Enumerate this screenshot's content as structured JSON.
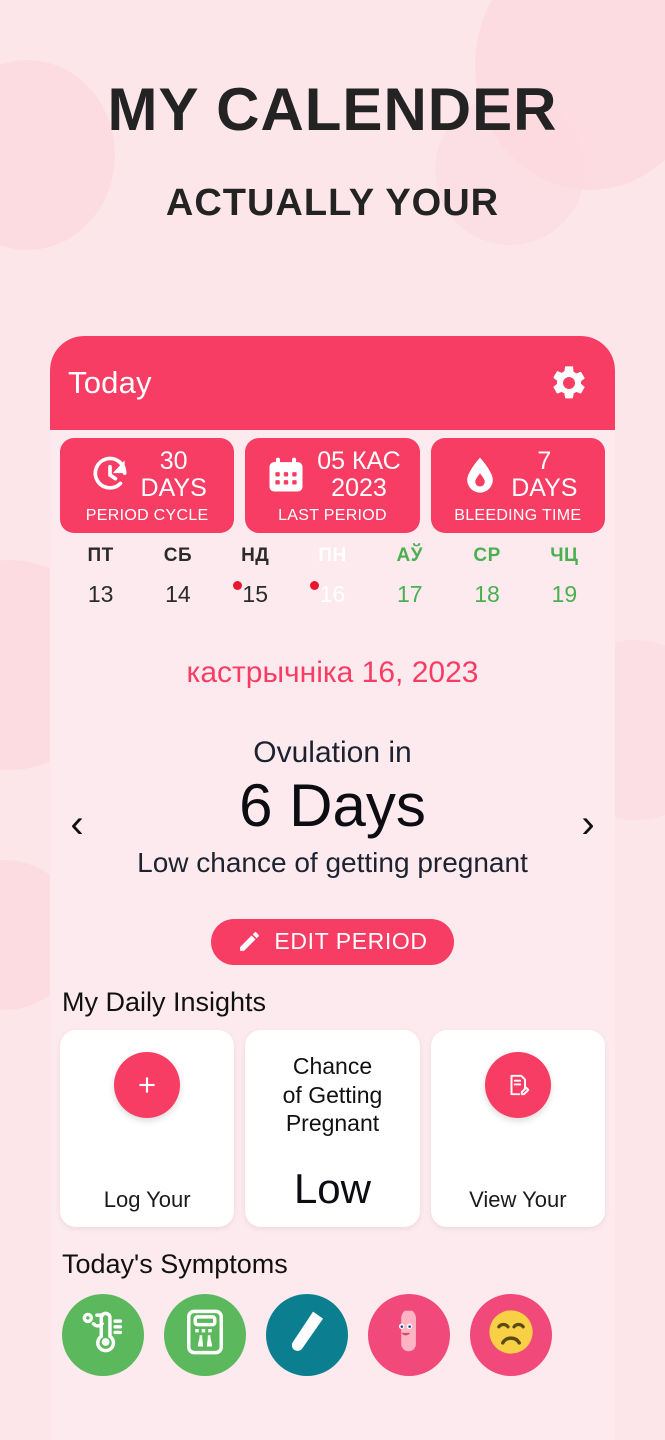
{
  "promo": {
    "title": "MY CALENDER",
    "subtitle": "ACTUALLY YOUR"
  },
  "colors": {
    "accent": "#f73d63",
    "background": "#fde6ea",
    "phone_background": "#fdeaee",
    "future_day": "#4caf50",
    "dot": "#e8172e",
    "card_white": "#ffffff"
  },
  "app": {
    "header": {
      "title": "Today",
      "settings_icon": "gear-icon"
    },
    "stats": [
      {
        "icon": "cycle-clock-icon",
        "value": "30\nDAYS",
        "value_line1": "30",
        "value_line2": "DAYS",
        "label": "PERIOD CYCLE"
      },
      {
        "icon": "calendar-icon",
        "value_line1": "05 КАС",
        "value_line2": "2023",
        "label": "LAST PERIOD"
      },
      {
        "icon": "blood-drop-icon",
        "value_line1": "7",
        "value_line2": "DAYS",
        "label": "BLEEDING TIME"
      }
    ],
    "week": [
      {
        "dow": "ПТ",
        "day": "13",
        "state": "past",
        "dot": false
      },
      {
        "dow": "СБ",
        "day": "14",
        "state": "past",
        "dot": false
      },
      {
        "dow": "НД",
        "day": "15",
        "state": "past",
        "dot": true
      },
      {
        "dow": "ПН",
        "day": "16",
        "state": "today",
        "dot": true
      },
      {
        "dow": "АЎ",
        "day": "17",
        "state": "future",
        "dot": false
      },
      {
        "dow": "СР",
        "day": "18",
        "state": "future",
        "dot": false
      },
      {
        "dow": "ЧЦ",
        "day": "19",
        "state": "future",
        "dot": false
      }
    ],
    "selected_date": "кастрычніка 16, 2023",
    "ovulation": {
      "label": "Ovulation in",
      "value": "6 Days",
      "chance": "Low chance of getting pregnant",
      "prev_icon": "chevron-left-icon",
      "next_icon": "chevron-right-icon"
    },
    "edit_button": {
      "label": "EDIT PERIOD",
      "icon": "pencil-icon"
    },
    "insights": {
      "title": "My Daily Insights",
      "cards": [
        {
          "icon": "plus-icon",
          "caption": "Log Your"
        },
        {
          "heading": "Chance\nof Getting\nPregnant",
          "heading_l1": "Chance",
          "heading_l2": "of Getting",
          "heading_l3": "Pregnant",
          "value": "Low"
        },
        {
          "icon": "note-edit-icon",
          "caption": "View Your"
        }
      ]
    },
    "symptoms": {
      "title": "Today's Symptoms",
      "items": [
        {
          "icon": "thermometer-icon",
          "color": "#5cb85c"
        },
        {
          "icon": "weight-scale-icon",
          "color": "#5cb85c"
        },
        {
          "icon": "test-strip-icon",
          "color": "#0b7f8f"
        },
        {
          "icon": "condom-character-icon",
          "color": "#f0497a"
        },
        {
          "icon": "sad-face-icon",
          "color": "#f0497a"
        }
      ]
    }
  }
}
